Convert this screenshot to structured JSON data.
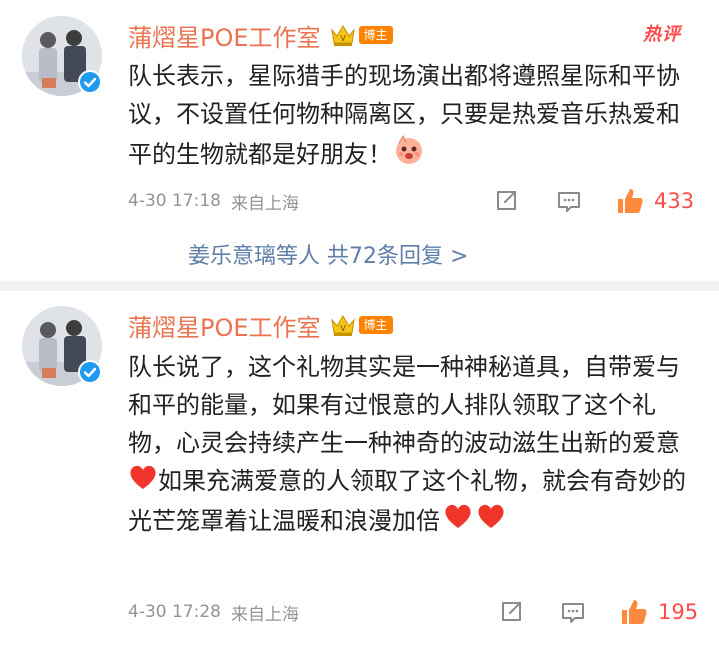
{
  "hot_label": "热评",
  "colors": {
    "author": "#eb7350",
    "link": "#5d7fa9",
    "like": "#ff4b4b",
    "meta": "#939393"
  },
  "comments": [
    {
      "author": "蒲熠星POE工作室",
      "badge_label": "博主",
      "text": "队长表示，星际猎手的现场演出都将遵照星际和平协议，不设置任何物种隔离区，只要是热爱音乐热爱和平的生物就都是好朋友！",
      "emoji": "laughing-emoji",
      "date": "4-30 17:18",
      "source": "来自上海",
      "likes": "433",
      "replies_text": "姜乐意璃等人 共72条回复 >"
    },
    {
      "author": "蒲熠星POE工作室",
      "badge_label": "博主",
      "text_part1": "队长说了，这个礼物其实是一种神秘道具，自带爱与和平的能量，如果有过恨意的人排队领取了这个礼物，心灵会持续产生一种神奇的波动滋生出新的爱意",
      "text_part2": "如果充满爱意的人领取了这个礼物，就会有奇妙的光芒笼罩着让温暖和浪漫加倍",
      "emoji": "heart-emoji",
      "date": "4-30 17:28",
      "source": "来自上海",
      "likes": "195"
    }
  ]
}
